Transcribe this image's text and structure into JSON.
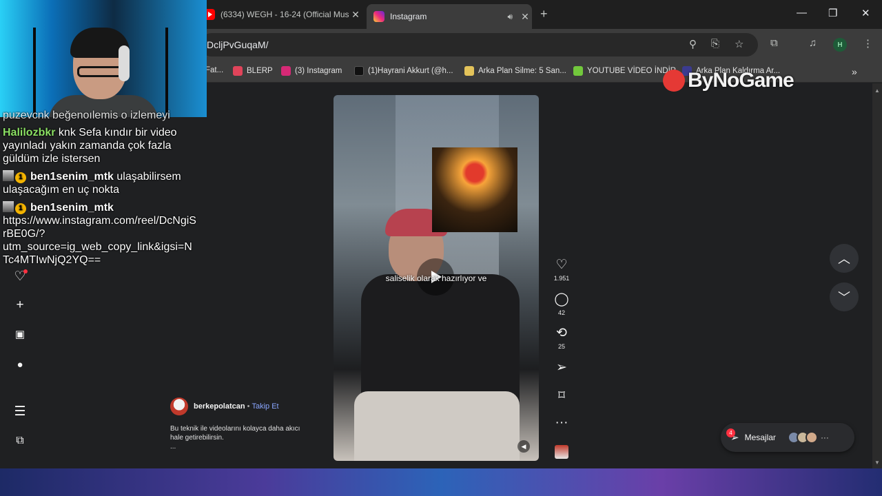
{
  "tabs": [
    {
      "title": "(6334) WEGH - 16-24 (Official Mus",
      "close": "✕"
    },
    {
      "title": "Instagram",
      "close": "✕"
    }
  ],
  "window_controls": {
    "minimize": "—",
    "maximize": "❐",
    "close": "✕",
    "new_tab": "+"
  },
  "address_bar": {
    "url": "DcljPvGuqaM/"
  },
  "profile_initial": "H",
  "bookmarks": [
    {
      "label": "Fat...",
      "color": "#5b8def"
    },
    {
      "label": "BLERP",
      "color": "#e0445a"
    },
    {
      "label": "(3) Instagram",
      "color": "#d62976"
    },
    {
      "label": "(1)Hayrani Akkurt (@h...",
      "color": "#111111"
    },
    {
      "label": "Arka Plan Silme: 5 San...",
      "color": "#e3c35a"
    },
    {
      "label": "YOUTUBE VİDEO İNDİR",
      "color": "#72c83c"
    },
    {
      "label": "Arka Plan Kaldırma Ar...",
      "color": "#3b3b8f"
    }
  ],
  "watermark": "ByNoGame",
  "chat": {
    "partial_line": "puzevcnk beğenoılemis o izlemeyi",
    "messages": [
      {
        "user": "Halilozbkr",
        "text_l1": "knk Sefa kındır bir video",
        "text_l2": "yayınladı yakın zamanda çok fazla",
        "text_l3": "güldüm izle istersen"
      },
      {
        "user": "ben1senim_mtk",
        "badge": "1",
        "text_l1": "ulaşabilirsem",
        "text_l2": "ulaşacağım en uç nokta"
      },
      {
        "user": "ben1senim_mtk",
        "badge": "1",
        "text_l1": "https://www.instagram.com/reel/DcNgiS",
        "text_l2": "rBE0G/?",
        "text_l3": "utm_source=ig_web_copy_link&igsi=N",
        "text_l4": "Tc4MTIwNjQ2YQ=="
      }
    ]
  },
  "reel": {
    "subtitle": "saliselik olarak hazırlıyor ve",
    "likes": "1.951",
    "comments": "42",
    "reposts": "25",
    "author": "berkepolatcan",
    "separator": "•",
    "follow": "Takip Et",
    "caption_l1": "Bu teknik ile videolarını kolayca daha akıcı",
    "caption_l2": "hale getirebilirsin.",
    "caption_more": "..."
  },
  "messages_bar": {
    "label": "Mesajlar",
    "count": "4",
    "more": "···"
  },
  "colors": {
    "follow": "#8aa6ff",
    "chat_green": "#8be064",
    "notification": "#ff3040"
  }
}
